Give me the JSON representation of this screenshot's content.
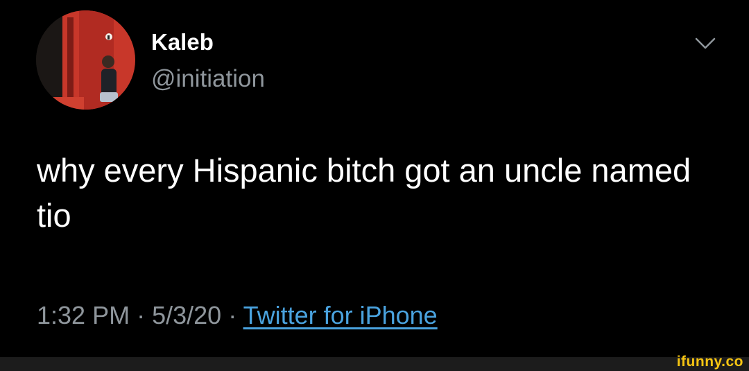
{
  "tweet": {
    "author_name": "Kaleb",
    "author_handle": "@initiation",
    "text": "why every Hispanic bitch got an uncle named tio",
    "time": "1:32 PM",
    "date": "5/3/20",
    "separator": "·",
    "source": "Twitter for iPhone"
  },
  "icons": {
    "menu": "chevron-down-icon",
    "avatar": "profile-photo"
  },
  "watermark": "ifunny.co",
  "colors": {
    "background": "#000000",
    "primary_text": "#ffffff",
    "secondary_text": "#8f969c",
    "link": "#4aa3df",
    "watermark": "#f6c512"
  }
}
